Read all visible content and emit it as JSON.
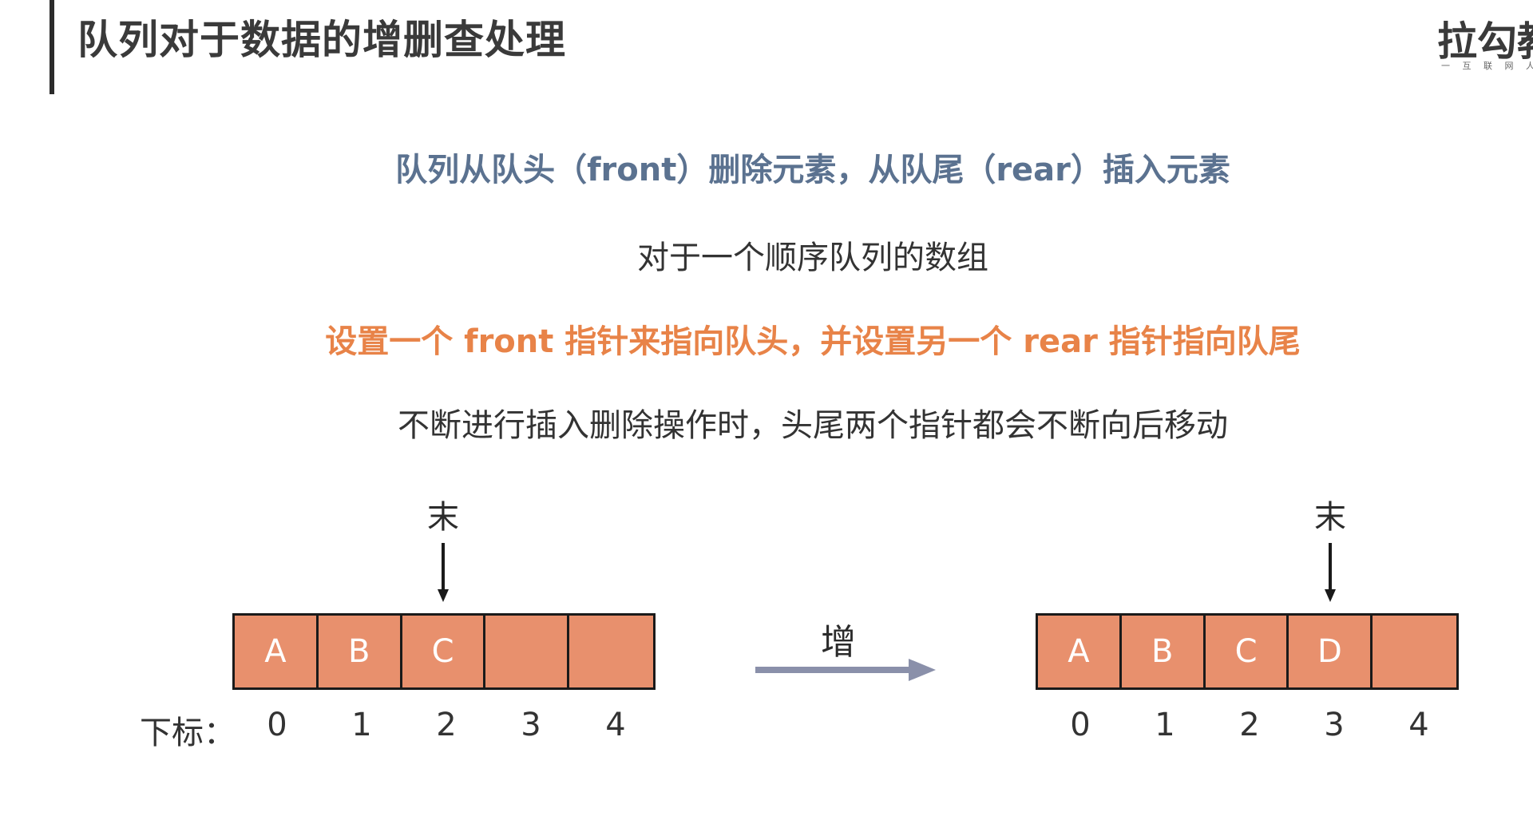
{
  "header": {
    "title": "队列对于数据的增删查处理",
    "logo": "拉勾教",
    "logo_sub": "一  互 联 网 人 实"
  },
  "content": {
    "line1": "队列从队头（front）删除元素，从队尾（rear）插入元素",
    "line2": "对于一个顺序队列的数组",
    "line3": "设置一个 front 指针来指向队头，并设置另一个 rear 指针指向队尾",
    "line4": "不断进行插入删除操作时，头尾两个指针都会不断向后移动"
  },
  "diagram": {
    "index_label": "下标：",
    "operation": "增",
    "before": {
      "pointer_label": "末",
      "pointer_index": 2,
      "cells": [
        "A",
        "B",
        "C",
        "",
        ""
      ],
      "indices": [
        "0",
        "1",
        "2",
        "3",
        "4"
      ]
    },
    "after": {
      "pointer_label": "末",
      "pointer_index": 3,
      "cells": [
        "A",
        "B",
        "C",
        "D",
        ""
      ],
      "indices": [
        "0",
        "1",
        "2",
        "3",
        "4"
      ]
    }
  },
  "colors": {
    "cell_fill": "#e8906d",
    "line1": "#5b7290",
    "line3": "#e88348",
    "arrow": "#8a90aa"
  }
}
